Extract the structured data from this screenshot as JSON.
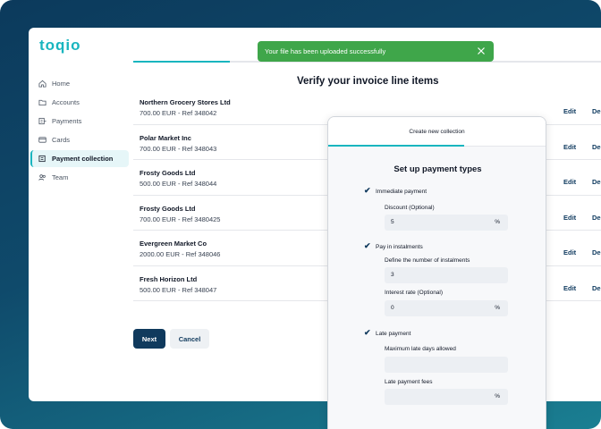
{
  "brand": {
    "logo": "toqio"
  },
  "toast": {
    "message": "Your file has been uploaded successfully"
  },
  "sidebar": {
    "items": [
      {
        "label": "Home",
        "icon": "home-icon"
      },
      {
        "label": "Accounts",
        "icon": "folder-icon"
      },
      {
        "label": "Payments",
        "icon": "payments-icon"
      },
      {
        "label": "Cards",
        "icon": "card-icon"
      },
      {
        "label": "Payment collection",
        "icon": "collection-icon",
        "active": true
      },
      {
        "label": "Team",
        "icon": "team-icon"
      }
    ]
  },
  "main": {
    "title": "Verify your invoice line items",
    "rows": [
      {
        "name": "Northern Grocery Stores Ltd",
        "detail": "700.00 EUR - Ref 348042",
        "edit": "Edit",
        "delete": "De"
      },
      {
        "name": "Polar Market Inc",
        "detail": "700.00 EUR - Ref 348043",
        "edit": "Edit",
        "delete": "De"
      },
      {
        "name": "Frosty Goods Ltd",
        "detail": "500.00 EUR - Ref 348044",
        "edit": "Edit",
        "delete": "De"
      },
      {
        "name": "Frosty Goods Ltd",
        "detail": "700.00 EUR - Ref 3480425",
        "edit": "Edit",
        "delete": "De"
      },
      {
        "name": "Evergreen Market Co",
        "detail": "2000.00 EUR - Ref 348046",
        "edit": "Edit",
        "delete": "De"
      },
      {
        "name": "Fresh Horizon Ltd",
        "detail": "500.00 EUR - Ref 348047",
        "edit": "Edit",
        "delete": "De"
      }
    ],
    "next_label": "Next",
    "cancel_label": "Cancel"
  },
  "modal": {
    "header": "Create new collection",
    "title": "Set up payment types",
    "immediate": {
      "label": "Immediate payment",
      "checked": true,
      "discount_label": "Discount (Optional)",
      "discount_value": "5",
      "discount_suffix": "%"
    },
    "instalments": {
      "label": "Pay in instalments",
      "checked": true,
      "count_label": "Define the number of instalments",
      "count_value": "3",
      "rate_label": "Interest rate (Optional)",
      "rate_value": "0",
      "rate_suffix": "%"
    },
    "late": {
      "label": "Late payment",
      "checked": true,
      "days_label": "Maximum late days allowed",
      "days_value": "",
      "fees_label": "Late payment fees",
      "fees_value": "",
      "fees_suffix": "%"
    }
  },
  "colors": {
    "accent": "#19b5bf",
    "primary": "#103a5d",
    "toast": "#3fa64a"
  }
}
